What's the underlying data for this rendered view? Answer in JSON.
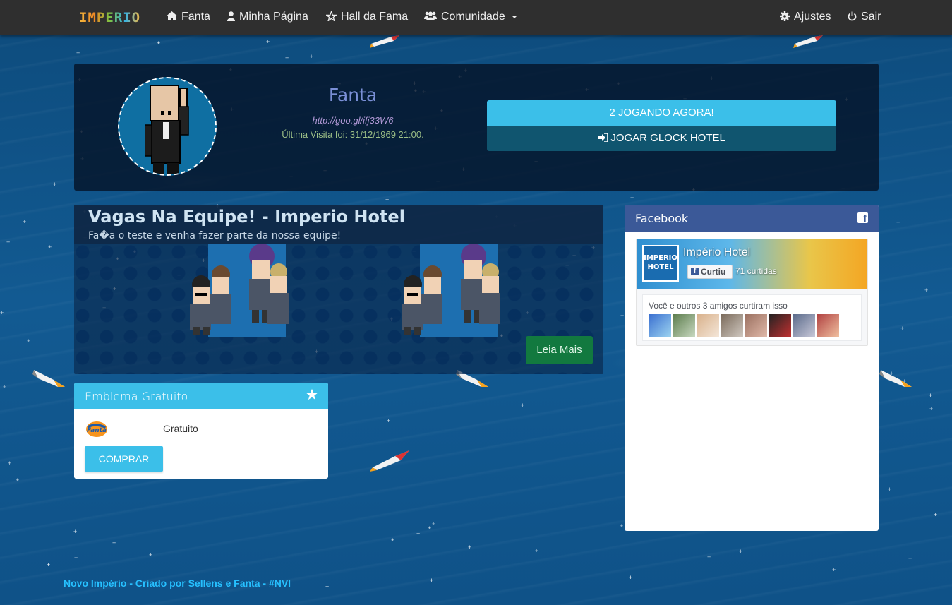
{
  "nav": {
    "brand": "IMPERIO",
    "items": [
      {
        "icon": "home-icon",
        "label": "Fanta"
      },
      {
        "icon": "user-icon",
        "label": "Minha Página"
      },
      {
        "icon": "star-outline-icon",
        "label": "Hall da Fama"
      },
      {
        "icon": "users-icon",
        "label": "Comunidade"
      }
    ],
    "settings": "Ajustes",
    "logout": "Sair"
  },
  "profile": {
    "name": "Fanta",
    "url": "http://goo.gl/ifj33W6",
    "last_visit": "Última Visita foi: 31/12/1969 21:00.",
    "online_label": "2 JOGANDO AGORA!",
    "play_label": "JOGAR GLOCK HOTEL"
  },
  "news": {
    "title": "Vagas Na Equipe! - Imperio Hotel",
    "subtitle": "Fa�a o teste e venha fazer parte da nossa equipe!",
    "read_more": "Leia Mais"
  },
  "badge": {
    "title": "Emblema Gratuito",
    "logo_text": "Fanta",
    "price": "Gratuito",
    "buy_label": "COMPRAR"
  },
  "facebook": {
    "title": "Facebook",
    "page_name": "Império Hotel",
    "page_pic_text": "IMPERIO HOTEL",
    "like_label": "Curtiu",
    "likes": "71 curtidas",
    "friends_text": "Você e outros 3 amigos curtiram isso"
  },
  "footer": {
    "text": "Novo Império - Criado por Sellens e Fanta - #NVI"
  },
  "colors": {
    "navbar": "#2f2f2f",
    "accent": "#3bbfe9",
    "play": "#10556f",
    "readmore": "#12793f",
    "facebook": "#3b5998",
    "footer_text": "#26c0ff"
  }
}
